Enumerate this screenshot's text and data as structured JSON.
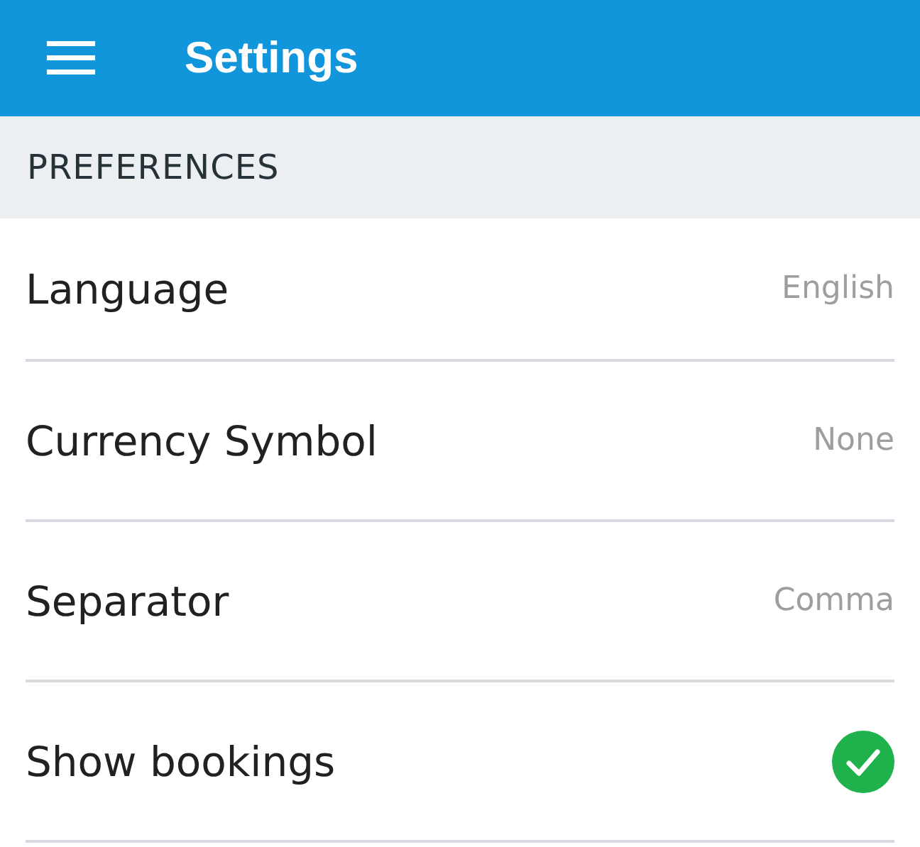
{
  "app_bar": {
    "title": "Settings"
  },
  "section": {
    "title": "PREFERENCES"
  },
  "rows": [
    {
      "kind": "value",
      "label": "Language",
      "value": "English"
    },
    {
      "kind": "value",
      "label": "Currency Symbol",
      "value": "None"
    },
    {
      "kind": "value",
      "label": "Separator",
      "value": "Comma"
    },
    {
      "kind": "check",
      "label": "Show bookings",
      "checked": true
    }
  ]
}
